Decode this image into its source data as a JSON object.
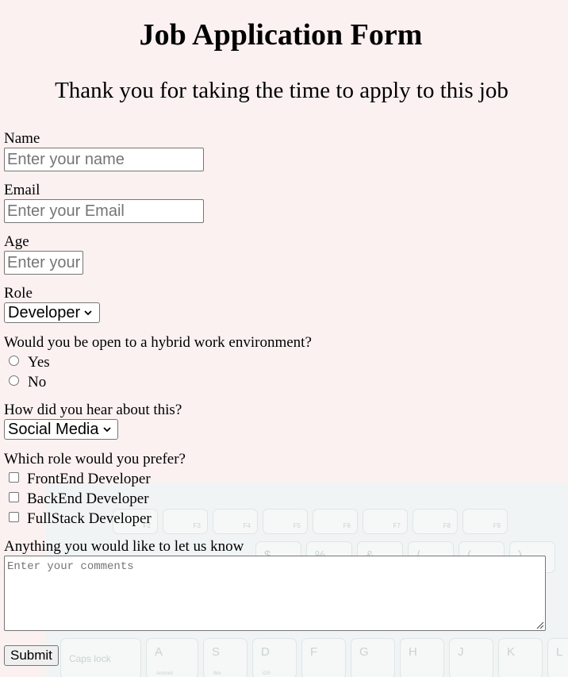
{
  "header": {
    "title": "Job Application Form",
    "subtitle": "Thank you for taking the time to apply to this job"
  },
  "form": {
    "name": {
      "label": "Name",
      "value": "",
      "placeholder": "Enter your name"
    },
    "email": {
      "label": "Email",
      "value": "",
      "placeholder": "Enter your Email"
    },
    "age": {
      "label": "Age",
      "value": "",
      "placeholder": "Enter your age"
    },
    "role": {
      "label": "Role",
      "selected": "Developer"
    },
    "hybrid": {
      "question": "Would you be open to a hybrid work environment?",
      "options": [
        "Yes",
        "No"
      ]
    },
    "source": {
      "label": "How did you hear about this?",
      "selected": "Social Media"
    },
    "preferred_role": {
      "question": "Which role would you prefer?",
      "options": [
        "FrontEnd Developer",
        "BackEnd Developer",
        "FullStack Developer"
      ]
    },
    "comments": {
      "label": "Anything you would like to let us know",
      "placeholder": "Enter your comments"
    },
    "submit_label": "Submit"
  },
  "background_keyboard": {
    "fn_keys": [
      "F2",
      "F3",
      "F4",
      "F5",
      "F6",
      "F7",
      "F8",
      "F9"
    ],
    "number_row": [
      "$",
      "%",
      "&",
      "/",
      "(",
      ")"
    ],
    "home_row_letters": [
      "A",
      "S",
      "D",
      "F",
      "G",
      "H",
      "J",
      "K",
      "L"
    ],
    "home_row_sublabels": [
      "Android",
      "iMe",
      "iOS"
    ],
    "caps_label": "Caps lock"
  }
}
